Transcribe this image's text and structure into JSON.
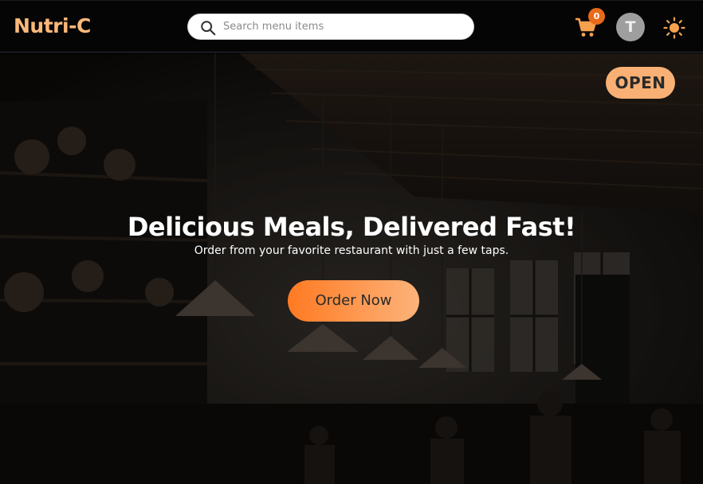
{
  "header": {
    "logo": "Nutri-C",
    "search": {
      "placeholder": "Search menu items",
      "value": ""
    },
    "cart": {
      "icon": "cart-icon",
      "count": "0"
    },
    "avatar": {
      "initial": "T"
    },
    "theme_toggle": {
      "icon": "sun-icon"
    }
  },
  "hero": {
    "status_badge": "OPEN",
    "headline": "Delicious Meals, Delivered Fast!",
    "subline": "Order from your favorite restaurant with just a few taps.",
    "cta_label": "Order Now"
  },
  "colors": {
    "brand": "#fdb97a",
    "accent": "#ff7a22",
    "badge": "#e86a1a",
    "open_badge": "#f8b074"
  }
}
